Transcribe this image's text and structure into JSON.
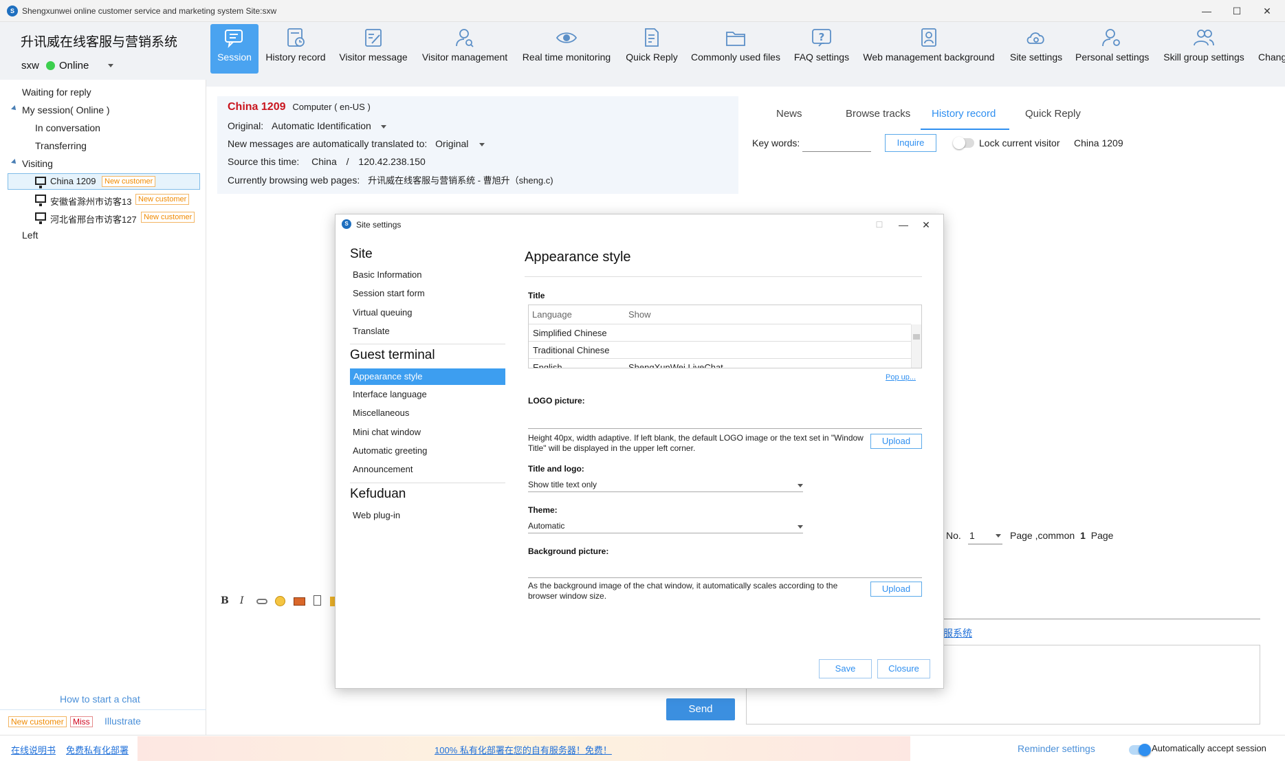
{
  "window": {
    "title": "Shengxunwei online customer service and marketing system  Site:sxw",
    "app_icon": "S",
    "controls": {
      "minimize": "—",
      "maximize": "☐",
      "close": "✕"
    }
  },
  "header": {
    "app_name": "升讯威在线客服与营销系统",
    "user": "sxw",
    "status": "Online",
    "status_color": "#3ccf4e"
  },
  "toolbar": {
    "items": [
      {
        "label": "Session",
        "icon": "chat-icon",
        "active": true
      },
      {
        "label": "History record",
        "icon": "history-icon"
      },
      {
        "label": "Visitor message",
        "icon": "message-edit-icon"
      },
      {
        "label": "Visitor management",
        "icon": "user-search-icon"
      },
      {
        "label": "Real time monitoring",
        "icon": "eye-icon"
      },
      {
        "label": "Quick Reply",
        "icon": "document-edit-icon"
      },
      {
        "label": "Commonly used files",
        "icon": "folder-icon"
      },
      {
        "label": "FAQ settings",
        "icon": "question-icon"
      },
      {
        "label": "Web management background",
        "icon": "admin-icon"
      },
      {
        "label": "Site settings",
        "icon": "cloud-gear-icon"
      },
      {
        "label": "Personal settings",
        "icon": "user-gear-icon"
      },
      {
        "label": "Skill group settings",
        "icon": "group-icon"
      },
      {
        "label": "Chang",
        "icon": "switch-icon"
      }
    ],
    "accent": "#4aa3f0"
  },
  "sidebar": {
    "waiting": "Waiting for reply",
    "my_session": "My session( Online )",
    "in_conversation": "In conversation",
    "transferring": "Transferring",
    "visiting": "Visiting",
    "visitors": [
      {
        "name": "China 1209",
        "tag": "New customer"
      },
      {
        "name": "安徽省滁州市访客13",
        "tag": "New customer"
      },
      {
        "name": "河北省邢台市访客127",
        "tag": "New customer"
      }
    ],
    "left": "Left",
    "how_to": "How to start a chat",
    "legend_new": "New customer",
    "legend_miss": "Miss",
    "illustrate": "Illustrate"
  },
  "visitor_info": {
    "name": "China 1209",
    "device": "Computer ( en-US )",
    "original_label": "Original:",
    "original_value": "Automatic Identification",
    "translate_label": "New messages are automatically translated to:",
    "translate_value": "Original",
    "source_label": "Source this time:",
    "source_country": "China",
    "source_sep": "/",
    "source_ip": "120.42.238.150",
    "browsing_label": "Currently browsing web pages:",
    "browsing_value": "升讯威在线客服与营销系统 - 曹旭升（sheng.c)"
  },
  "right_panel": {
    "tabs": [
      "News",
      "Browse tracks",
      "History record",
      "Quick Reply"
    ],
    "active_tab": "History record",
    "keywords_label": "Key words:",
    "keywords_value": "",
    "inquire": "Inquire",
    "lock_label": "Lock current visitor",
    "visitor": "China 1209",
    "pager_no": "No.",
    "pager_value": "1",
    "pager_page": "Page ,common",
    "pager_total": "1",
    "pager_suffix": "Page",
    "link_fragment": "服系统"
  },
  "editor": {
    "bold": "B",
    "italic": "I",
    "send": "Send"
  },
  "footer": {
    "manual": "在线说明书",
    "free_deploy": "免费私有化部署",
    "banner": "100% 私有化部署在您的自有服务器！免费！",
    "reminder": "Reminder settings",
    "auto_accept": "Automatically accept session"
  },
  "dialog": {
    "title": "Site settings",
    "controls": {
      "minimize": "—",
      "maximize": "☐",
      "close": "✕"
    },
    "nav": {
      "site_header": "Site",
      "site_items": [
        "Basic Information",
        "Session start form",
        "Virtual queuing",
        "Translate"
      ],
      "guest_header": "Guest terminal",
      "guest_items": [
        "Appearance style",
        "Interface language",
        "Miscellaneous",
        "Mini chat window",
        "Automatic greeting",
        "Announcement"
      ],
      "kefu_header": "Kefuduan",
      "kefu_items": [
        "Web plug-in"
      ]
    },
    "pane": {
      "title": "Appearance style",
      "title_label": "Title",
      "grid_headers": [
        "Language",
        "Show"
      ],
      "grid_rows": [
        {
          "lang": "Simplified Chinese",
          "show": ""
        },
        {
          "lang": "Traditional Chinese",
          "show": ""
        },
        {
          "lang": "English",
          "show": "ShengXunWei LiveChat"
        }
      ],
      "popup": "Pop up...",
      "logo_label": "LOGO picture:",
      "logo_hint": "Height 40px, width adaptive. If left blank, the default LOGO image or the text set in \"Window Title\" will be displayed in the upper left corner.",
      "upload": "Upload",
      "title_logo_label": "Title and logo:",
      "title_logo_value": "Show title text only",
      "theme_label": "Theme:",
      "theme_value": "Automatic",
      "bg_label": "Background picture:",
      "bg_hint": "As the background image of the chat window, it automatically scales according to the browser window size.",
      "save": "Save",
      "closure": "Closure"
    }
  },
  "colors": {
    "name_red": "#c9151e",
    "link_blue": "#1e6fd9",
    "tag_orange": "#f08a00",
    "selected_nav": "#3d9ef0"
  }
}
